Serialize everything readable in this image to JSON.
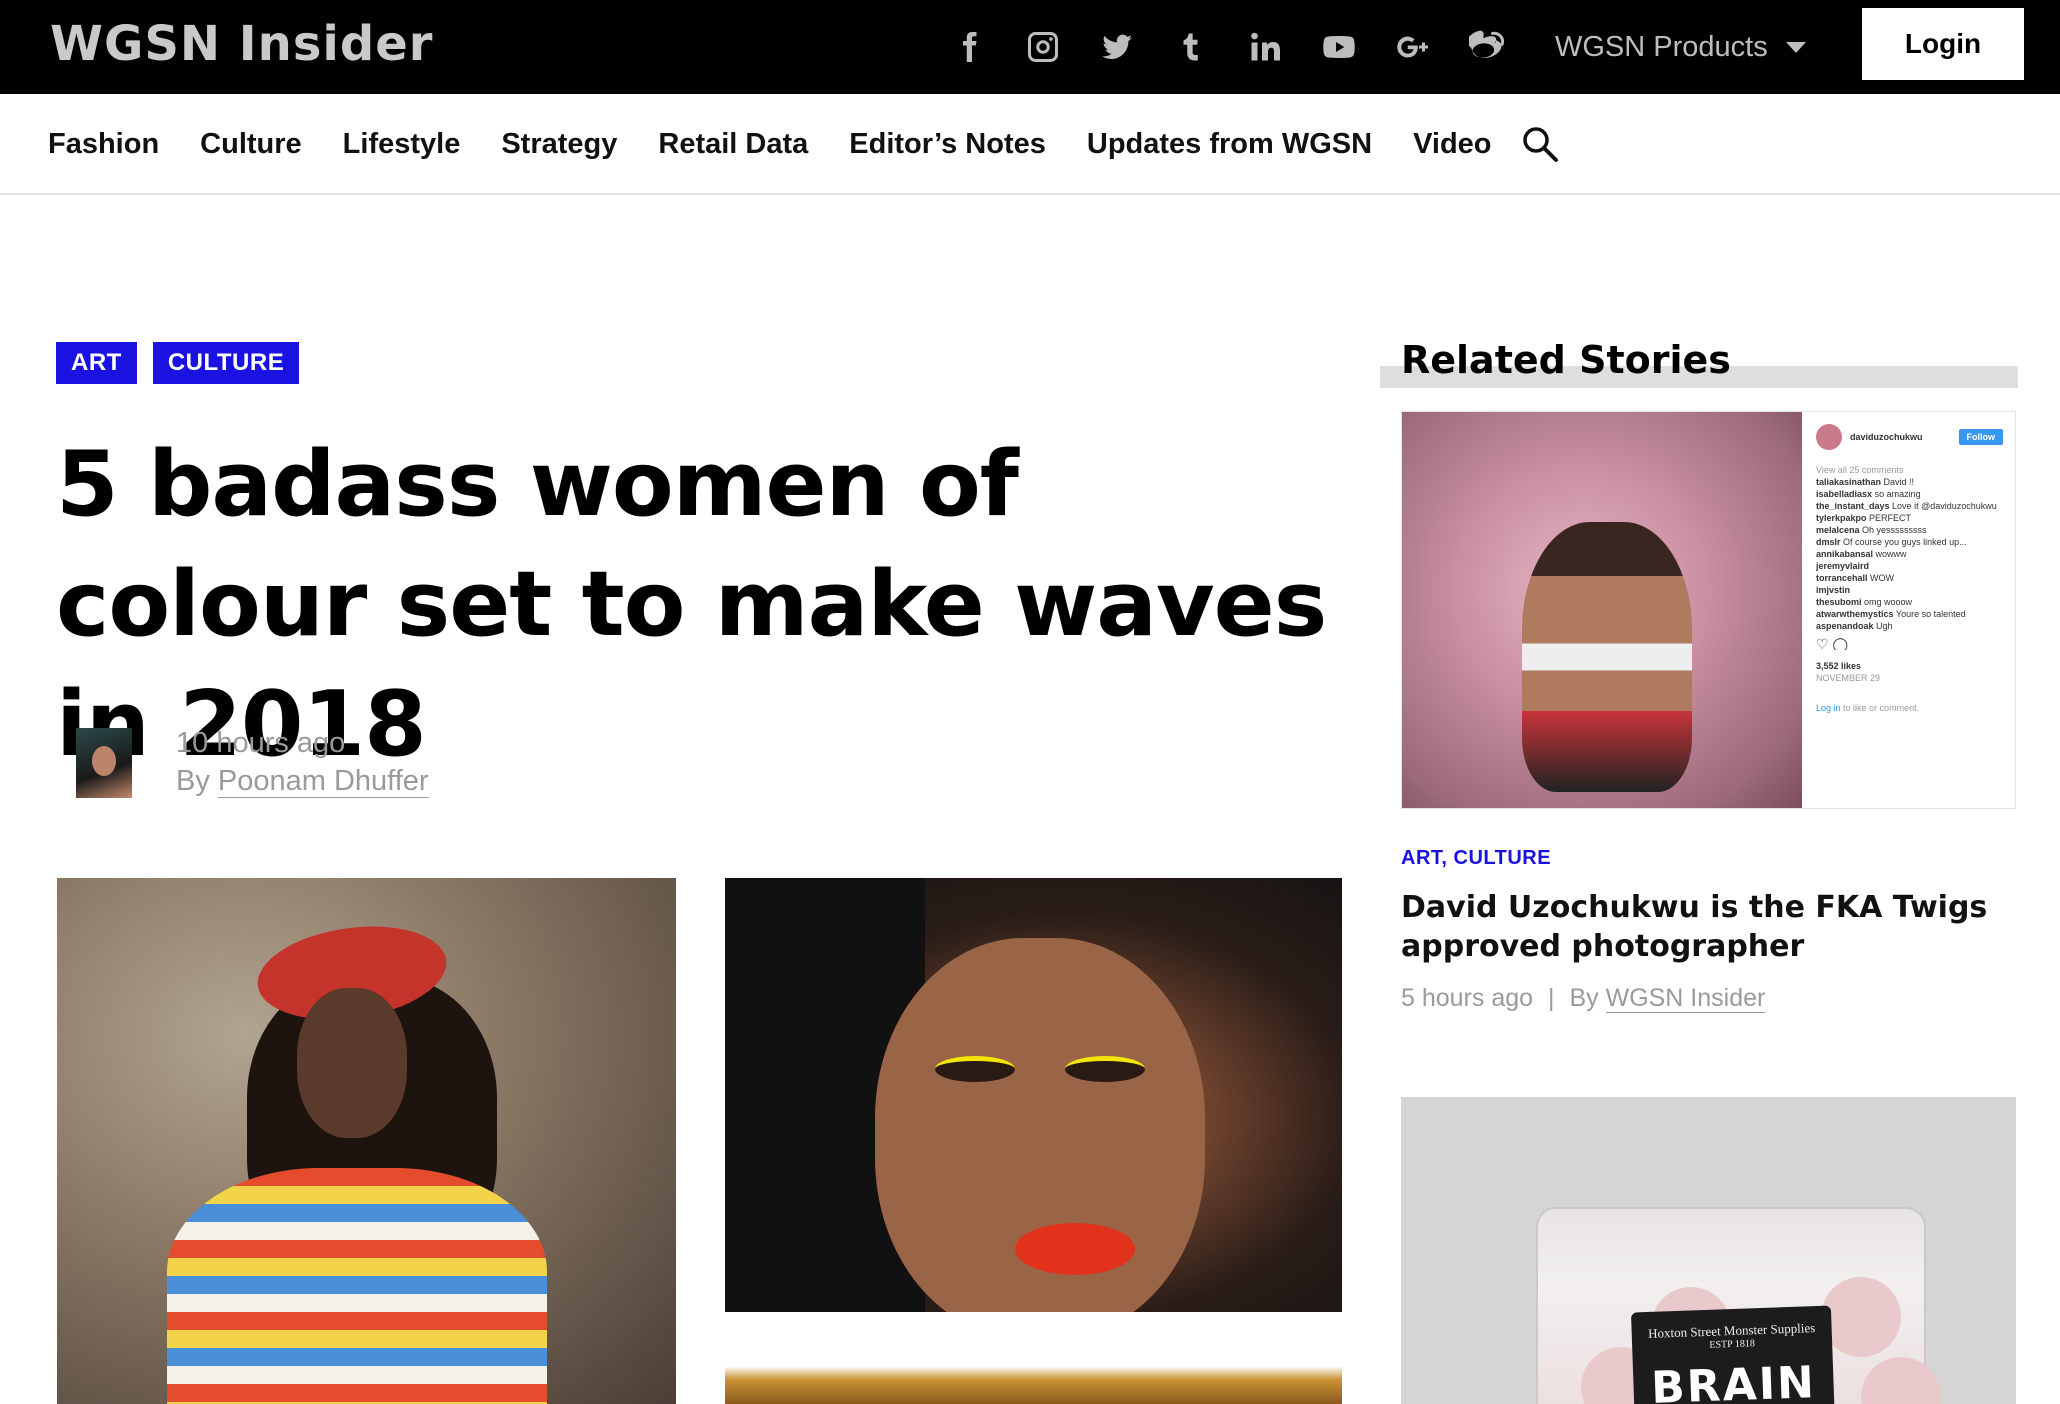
{
  "header": {
    "logo": "WGSN Insider",
    "social_icons": [
      "facebook-icon",
      "instagram-icon",
      "twitter-icon",
      "tumblr-icon",
      "linkedin-icon",
      "youtube-icon",
      "google-plus-icon",
      "weibo-icon"
    ],
    "products_label": "WGSN Products",
    "login_label": "Login"
  },
  "nav": {
    "items": [
      "Fashion",
      "Culture",
      "Lifestyle",
      "Strategy",
      "Retail Data",
      "Editor’s Notes",
      "Updates from WGSN",
      "Video"
    ]
  },
  "article": {
    "tags": [
      "ART",
      "CULTURE"
    ],
    "title": "5 badass women of colour set to make waves in 2018",
    "time": "10 hours ago",
    "by_prefix": "By",
    "author": "Poonam Dhuffer"
  },
  "sidebar": {
    "heading": "Related Stories",
    "card1": {
      "instagram": {
        "username": "daviduzochukwu",
        "follow": "Follow",
        "view_comments": "View all 25 comments",
        "comments": [
          {
            "user": "taliakasinathan",
            "text": "David !!"
          },
          {
            "user": "isabelladiasx",
            "text": "so amazing"
          },
          {
            "user": "the_instant_days",
            "text": "Love it @daviduzochukwu"
          },
          {
            "user": "tylerkpakpo",
            "text": "PERFECT"
          },
          {
            "user": "melalcena",
            "text": "Oh yesssssssss"
          },
          {
            "user": "dmslr",
            "text": "Of course you guys linked up..."
          },
          {
            "user": "annikabansal",
            "text": "wowww"
          },
          {
            "user": "jeremyvlaird",
            "text": ""
          },
          {
            "user": "torrancehall",
            "text": "WOW"
          },
          {
            "user": "imjvstin",
            "text": ""
          },
          {
            "user": "thesubomi",
            "text": "omg wooow"
          },
          {
            "user": "atwarwthemystics",
            "text": "Youre so talented"
          },
          {
            "user": "aspenandoak",
            "text": "Ugh"
          }
        ],
        "likes": "3,552 likes",
        "date": "NOVEMBER 29",
        "login_link": "Log in",
        "login_text": "to like or comment."
      },
      "tags": "ART, CULTURE",
      "title": "David Uzochukwu is the FKA Twigs approved photographer",
      "time": "5 hours ago",
      "separator": "|",
      "by_prefix": "By",
      "author": "WGSN Insider"
    },
    "card2": {
      "label_line1": "Hoxton Street Monster Supplies",
      "label_line2": "ESTP 1818",
      "label_big": "BRAIN"
    }
  }
}
